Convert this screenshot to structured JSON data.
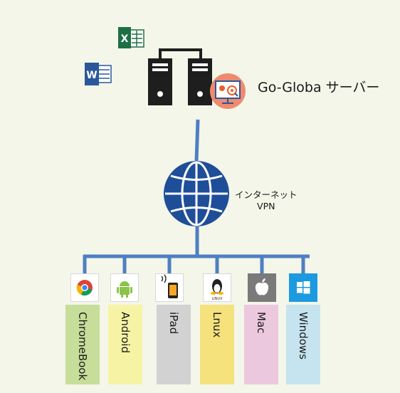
{
  "server": {
    "label": "Go-Globa サーバー"
  },
  "network": {
    "line1": "インターネット",
    "line2": "VPN"
  },
  "colors": {
    "line": "#4f7fc3",
    "globe": "#1f4e99",
    "server": "#1e1e1e",
    "badge": "#f08a6e"
  },
  "devices": [
    {
      "label": "ChromeBook",
      "color": "#c7dd9a",
      "icon": "chrome-icon"
    },
    {
      "label": "Android",
      "color": "#f6f3a4",
      "icon": "android-icon"
    },
    {
      "label": "iPad",
      "color": "#d2d2d2",
      "icon": "ipad-icon"
    },
    {
      "label": "Lnux",
      "color": "#f5e27c",
      "icon": "linux-tux-icon"
    },
    {
      "label": "Mac",
      "color": "#ecc8de",
      "icon": "apple-icon"
    },
    {
      "label": "Windows",
      "color": "#c5e4ef",
      "icon": "windows-icon"
    }
  ]
}
